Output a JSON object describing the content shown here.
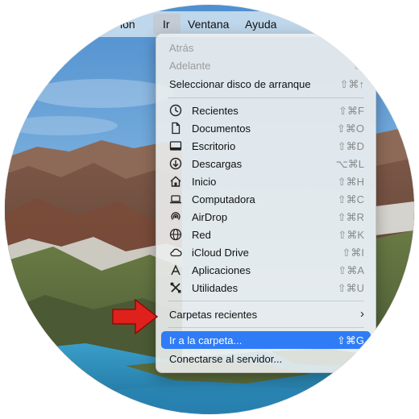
{
  "menubar": {
    "items": [
      "ión",
      "Ir",
      "Ventana",
      "Ayuda"
    ],
    "active": "Ir",
    "active_color": "#c3ccd5"
  },
  "menu": {
    "highlight_color": "#2f7cf6",
    "items": [
      {
        "label": "Atrás",
        "shortcut": "⌘",
        "enabled": false
      },
      {
        "label": "Adelante",
        "shortcut": "⌘",
        "enabled": false
      },
      {
        "label": "Seleccionar disco de arranque",
        "shortcut": "⇧⌘↑",
        "enabled": true
      },
      {
        "label": "Recientes",
        "shortcut": "⇧⌘F",
        "icon": "clock-icon"
      },
      {
        "label": "Documentos",
        "shortcut": "⇧⌘O",
        "icon": "document-icon"
      },
      {
        "label": "Escritorio",
        "shortcut": "⇧⌘D",
        "icon": "desktop-icon"
      },
      {
        "label": "Descargas",
        "shortcut": "⌥⌘L",
        "icon": "download-icon"
      },
      {
        "label": "Inicio",
        "shortcut": "⇧⌘H",
        "icon": "home-icon"
      },
      {
        "label": "Computadora",
        "shortcut": "⇧⌘C",
        "icon": "laptop-icon"
      },
      {
        "label": "AirDrop",
        "shortcut": "⇧⌘R",
        "icon": "airdrop-icon"
      },
      {
        "label": "Red",
        "shortcut": "⇧⌘K",
        "icon": "globe-icon"
      },
      {
        "label": "iCloud Drive",
        "shortcut": "⇧⌘I",
        "icon": "cloud-icon"
      },
      {
        "label": "Aplicaciones",
        "shortcut": "⇧⌘A",
        "icon": "applications-icon"
      },
      {
        "label": "Utilidades",
        "shortcut": "⇧⌘U",
        "icon": "tools-icon"
      },
      {
        "label": "Carpetas recientes",
        "shortcut": "›",
        "submenu": true
      },
      {
        "label": "Ir a la carpeta...",
        "shortcut": "⇧⌘G",
        "highlighted": true
      },
      {
        "label": "Conectarse al servidor...",
        "shortcut": "⌘"
      }
    ]
  },
  "annotation": {
    "arrow_color": "#e0201c"
  }
}
